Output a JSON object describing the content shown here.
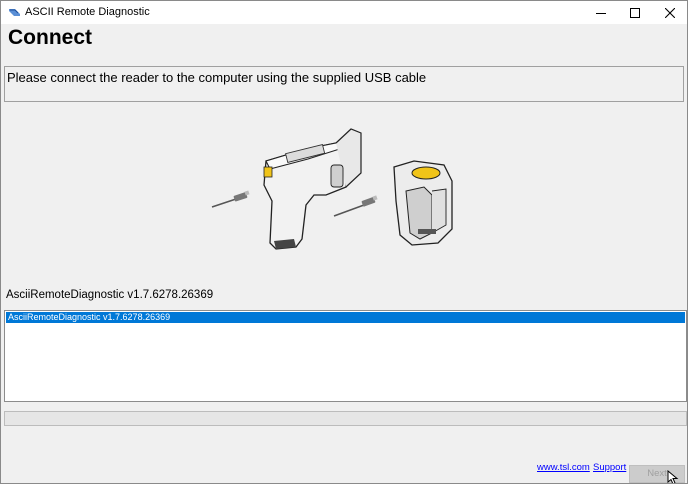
{
  "window": {
    "title": "ASCII Remote Diagnostic",
    "minimize_icon": "minimize-icon",
    "maximize_icon": "maximize-icon",
    "close_icon": "close-icon"
  },
  "page": {
    "heading": "Connect",
    "instruction": "Please connect the reader to the computer using the supplied USB cable",
    "illustration_icon": "usb-reader-illustration"
  },
  "version": {
    "label": "AsciiRemoteDiagnostic v1.7.6278.26369"
  },
  "log": {
    "items": [
      {
        "text": "AsciiRemoteDiagnostic v1.7.6278.26369",
        "selected": true
      }
    ]
  },
  "progress": {
    "value": 0
  },
  "footer": {
    "link_site": "www.tsl.com",
    "link_support": "Support",
    "next_label": "Next",
    "next_enabled": false
  },
  "colors": {
    "selection": "#0078d7",
    "link": "#0000ff",
    "accent_yellow": "#f0c419"
  }
}
